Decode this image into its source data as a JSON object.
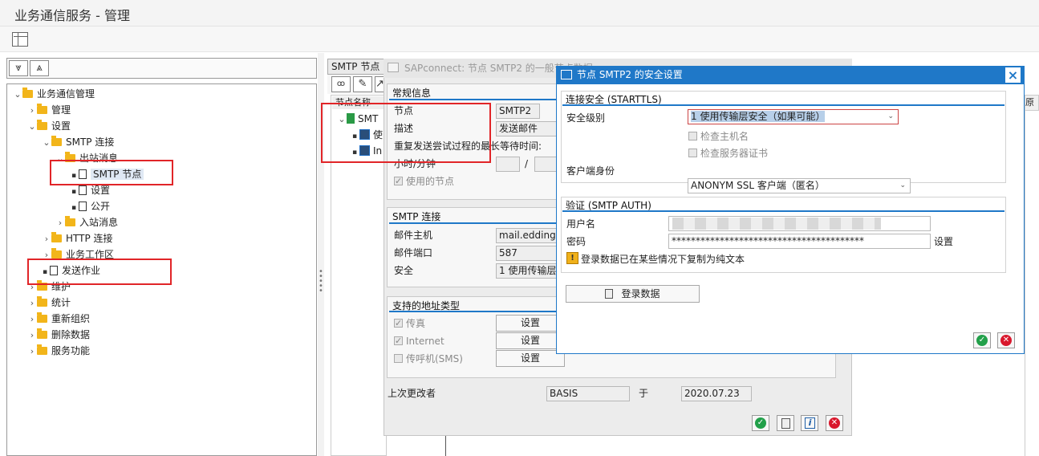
{
  "app": {
    "title": "业务通信服务 - 管理"
  },
  "left_toolbar": {
    "expand_label": "⩔",
    "collapse_label": "⩓"
  },
  "tree": {
    "root": "业务通信管理",
    "admin": "管理",
    "settings": "设置",
    "smtp_conn": "SMTP 连接",
    "outbound": "出站消息",
    "smtp_node": "SMTP 节点",
    "out_settings": "设置",
    "public": "公开",
    "inbound": "入站消息",
    "http_conn": "HTTP 连接",
    "business_area": "业务工作区",
    "send_job": "发送作业",
    "maintain": "维护",
    "statistics": "统计",
    "reorg": "重新组织",
    "delete_data": "删除数据",
    "service_func": "服务功能"
  },
  "node_panel": {
    "header": "SMTP 节点",
    "col_name": "节点名称",
    "row1": "SMT",
    "row2": "使",
    "row3": "In",
    "right_col": "原始"
  },
  "sapconnect": {
    "title": "SAPconnect: 节点 SMTP2 的一般节点数据",
    "general_title": "常规信息",
    "node_label": "节点",
    "node_value": "SMTP2",
    "desc_label": "描述",
    "desc_value": "发送邮件",
    "retry_label": "重复发送尝试过程的最长等待时间:",
    "hour_min_label": "小时/分钟",
    "slash": "/",
    "node_used": "使用的节点",
    "smtp_title": "SMTP 连接",
    "mail_host_label": "邮件主机",
    "mail_host_value": "mail.eddingph",
    "mail_port_label": "邮件端口",
    "mail_port_value": "587",
    "security_label": "安全",
    "security_value": "1 使用传输层",
    "addr_title": "支持的地址类型",
    "fax": "传真",
    "internet": "Internet",
    "pager": "传呼机(SMS)",
    "set_btn": "设置",
    "changed_by_label": "上次更改者",
    "changed_by_value": "BASIS",
    "on_label": "于",
    "date_value": "2020.07.23"
  },
  "security_dialog": {
    "title": "节点 SMTP2 的安全设置",
    "starttls_title": "连接安全 (STARTTLS)",
    "level_label": "安全级别",
    "level_value": "1 使用传输层安全（如果可能）",
    "check_host": "检查主机名",
    "check_cert": "检查服务器证书",
    "client_id_label": "客户端身份",
    "client_id_value": "ANONYM SSL 客户端（匿名）",
    "auth_title": "验证 (SMTP AUTH)",
    "username_label": "用户名",
    "password_label": "密码",
    "password_value": "****************************************",
    "password_set": "设置",
    "warning": "登录数据已在某些情况下复制为纯文本",
    "login_btn": "登录数据"
  }
}
